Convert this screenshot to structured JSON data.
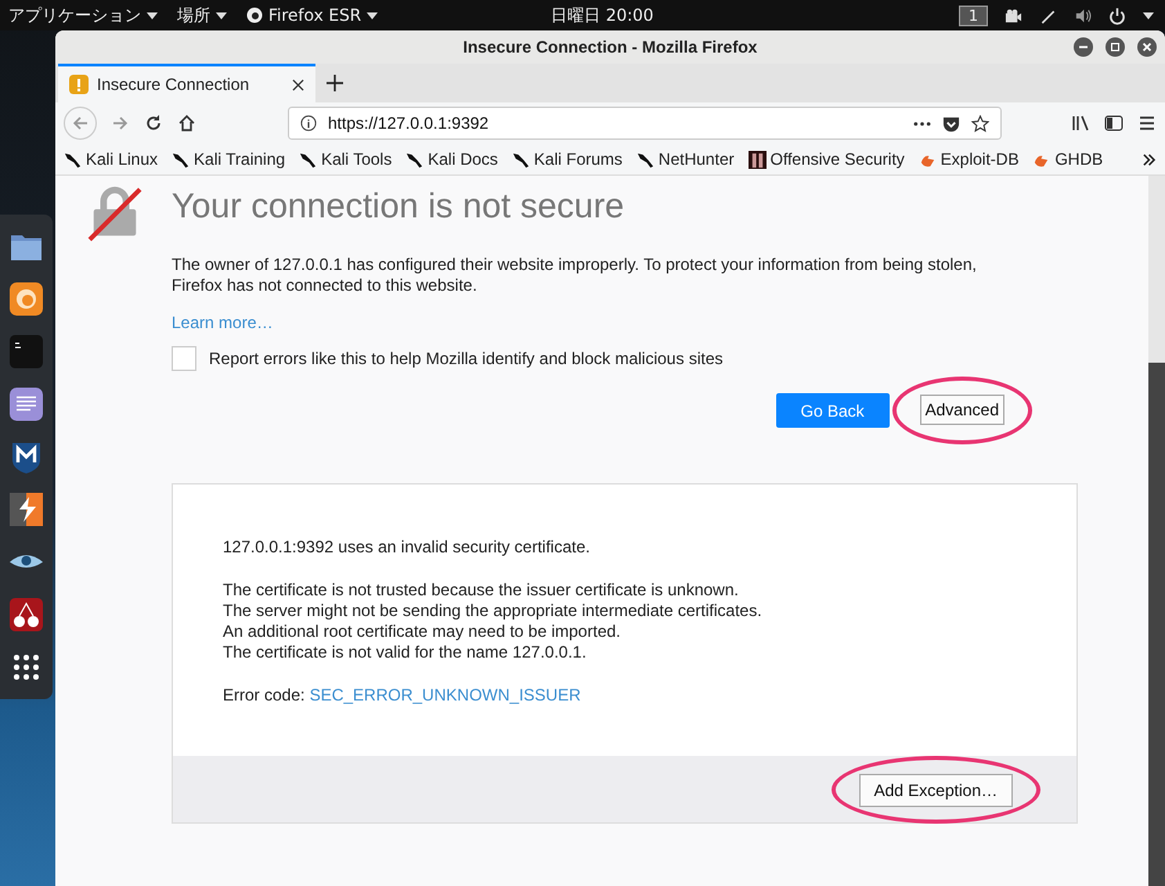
{
  "top_panel": {
    "menus": [
      {
        "label": "アプリケーション",
        "kind": "text"
      },
      {
        "label": "場所",
        "kind": "text"
      },
      {
        "label": "Firefox ESR",
        "kind": "app"
      }
    ],
    "clock": "日曜日 20:00",
    "workspace": "1"
  },
  "window": {
    "title": "Insecure Connection - Mozilla Firefox"
  },
  "tabs": [
    {
      "label": "Insecure Connection",
      "selected": true
    }
  ],
  "address_bar": {
    "url": "https://127.0.0.1:9392"
  },
  "bookmarks": [
    {
      "label": "Kali Linux",
      "kind": "dragon"
    },
    {
      "label": "Kali Training",
      "kind": "dragon"
    },
    {
      "label": "Kali Tools",
      "kind": "dragon"
    },
    {
      "label": "Kali Docs",
      "kind": "dragon"
    },
    {
      "label": "Kali Forums",
      "kind": "dragon"
    },
    {
      "label": "NetHunter",
      "kind": "dragon"
    },
    {
      "label": "Offensive Security",
      "kind": "badge"
    },
    {
      "label": "Exploit-DB",
      "kind": "flame"
    },
    {
      "label": "GHDB",
      "kind": "flame"
    }
  ],
  "page": {
    "title": "Your connection is not secure",
    "description": "The owner of 127.0.0.1 has configured their website improperly. To protect your information from being stolen, Firefox has not connected to this website.",
    "learn_more": "Learn more…",
    "report_checkbox": {
      "label": "Report errors like this to help Mozilla identify and block malicious sites",
      "checked": false
    },
    "buttons": [
      {
        "label": "Go Back",
        "kind": "primary",
        "highlighted": false
      },
      {
        "label": "Advanced",
        "kind": "secondary",
        "highlighted": true
      }
    ],
    "advanced_panel": {
      "intro": "127.0.0.1:9392 uses an invalid security certificate.",
      "details": [
        "The certificate is not trusted because the issuer certificate is unknown.",
        "The server might not be sending the appropriate intermediate certificates.",
        "An additional root certificate may need to be imported.",
        "The certificate is not valid for the name 127.0.0.1."
      ],
      "error_label": "Error code:",
      "error_code": "SEC_ERROR_UNKNOWN_ISSUER",
      "button": {
        "label": "Add Exception…",
        "highlighted": true
      }
    }
  }
}
